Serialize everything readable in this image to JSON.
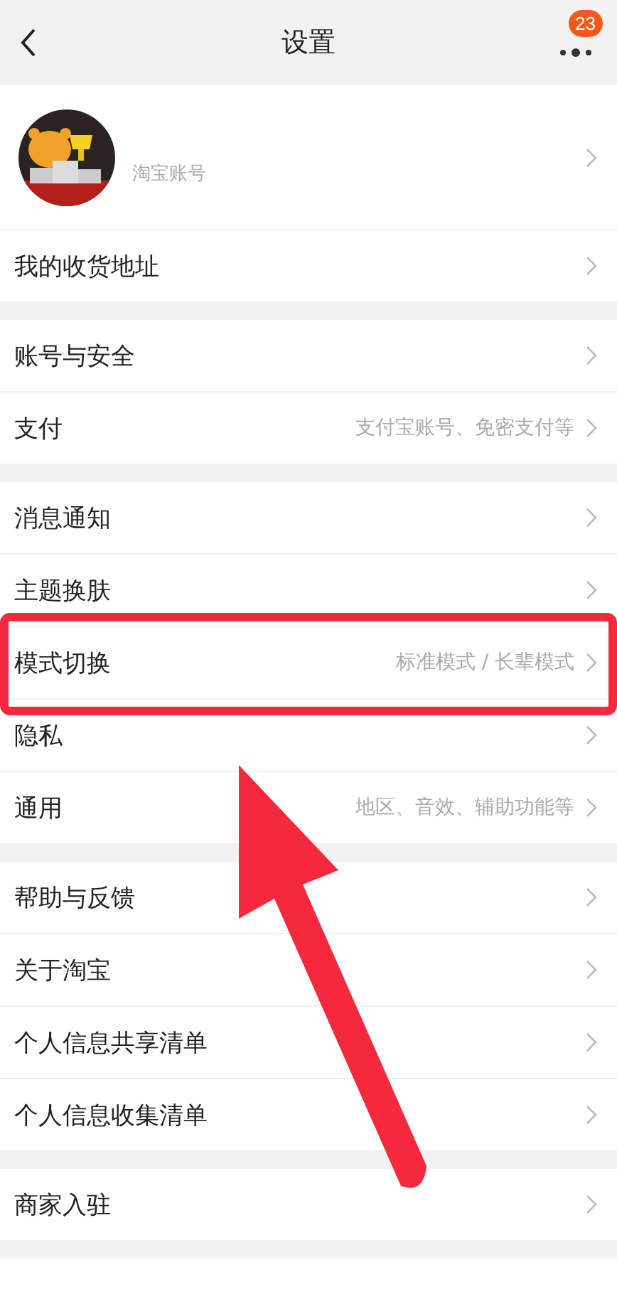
{
  "header": {
    "title": "设置",
    "badge": "23"
  },
  "profile": {
    "account_label": "淘宝账号"
  },
  "sections": [
    {
      "items": [
        {
          "label": "我的收货地址",
          "highlighted": false
        }
      ]
    },
    {
      "items": [
        {
          "label": "账号与安全",
          "highlighted": false
        },
        {
          "label": "支付",
          "detail": "支付宝账号、免密支付等",
          "highlighted": false
        }
      ]
    },
    {
      "items": [
        {
          "label": "消息通知",
          "highlighted": false
        },
        {
          "label": "主题换肤",
          "highlighted": false
        },
        {
          "label": "模式切换",
          "detail": "标准模式 / 长辈模式",
          "highlighted": true
        },
        {
          "label": "隐私",
          "highlighted": false
        },
        {
          "label": "通用",
          "detail": "地区、音效、辅助功能等",
          "highlighted": false
        }
      ]
    },
    {
      "items": [
        {
          "label": "帮助与反馈",
          "highlighted": false
        },
        {
          "label": "关于淘宝",
          "highlighted": false
        },
        {
          "label": "个人信息共享清单",
          "highlighted": false
        },
        {
          "label": "个人信息收集清单",
          "highlighted": false
        }
      ]
    },
    {
      "items": [
        {
          "label": "商家入驻",
          "highlighted": false
        }
      ]
    }
  ]
}
